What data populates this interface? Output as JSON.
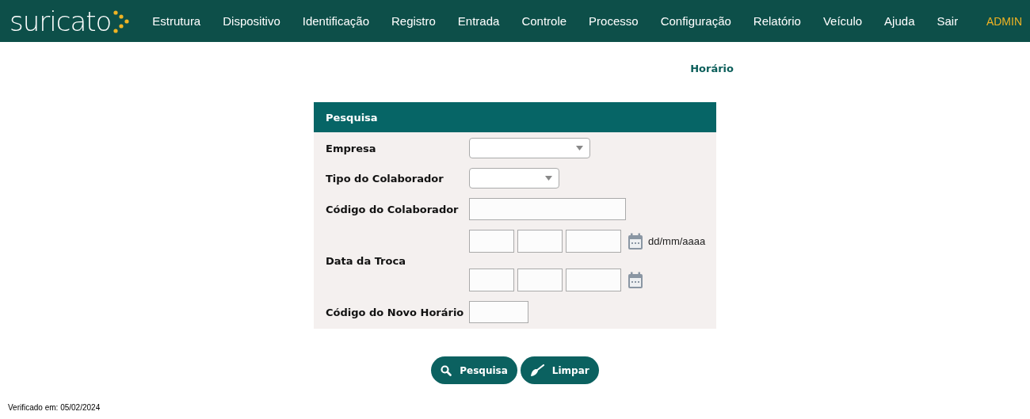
{
  "brand": {
    "name": "suricato"
  },
  "menu": [
    {
      "label": "Estrutura"
    },
    {
      "label": "Dispositivo"
    },
    {
      "label": "Identificação"
    },
    {
      "label": "Registro"
    },
    {
      "label": "Entrada"
    },
    {
      "label": "Controle"
    },
    {
      "label": "Processo"
    },
    {
      "label": "Configuração"
    },
    {
      "label": "Relatório"
    },
    {
      "label": "Veículo"
    },
    {
      "label": "Ajuda"
    },
    {
      "label": "Sair"
    }
  ],
  "user": "ADMIN",
  "page_title": "Horário",
  "panel": {
    "title": "Pesquisa",
    "fields": [
      {
        "label": "Empresa",
        "kind": "select"
      },
      {
        "label": "Tipo do Colaborador",
        "kind": "select"
      },
      {
        "label": "Código do Colaborador",
        "kind": "text"
      },
      {
        "label": "Data da Troca",
        "kind": "date-range",
        "hint": "dd/mm/aaaa"
      },
      {
        "label": "Código do Novo Horário",
        "kind": "text"
      }
    ]
  },
  "buttons": [
    {
      "label": "Pesquisa",
      "kind": "search"
    },
    {
      "label": "Limpar",
      "kind": "clear"
    }
  ],
  "footer": "Verificado em: 05/02/2024"
}
